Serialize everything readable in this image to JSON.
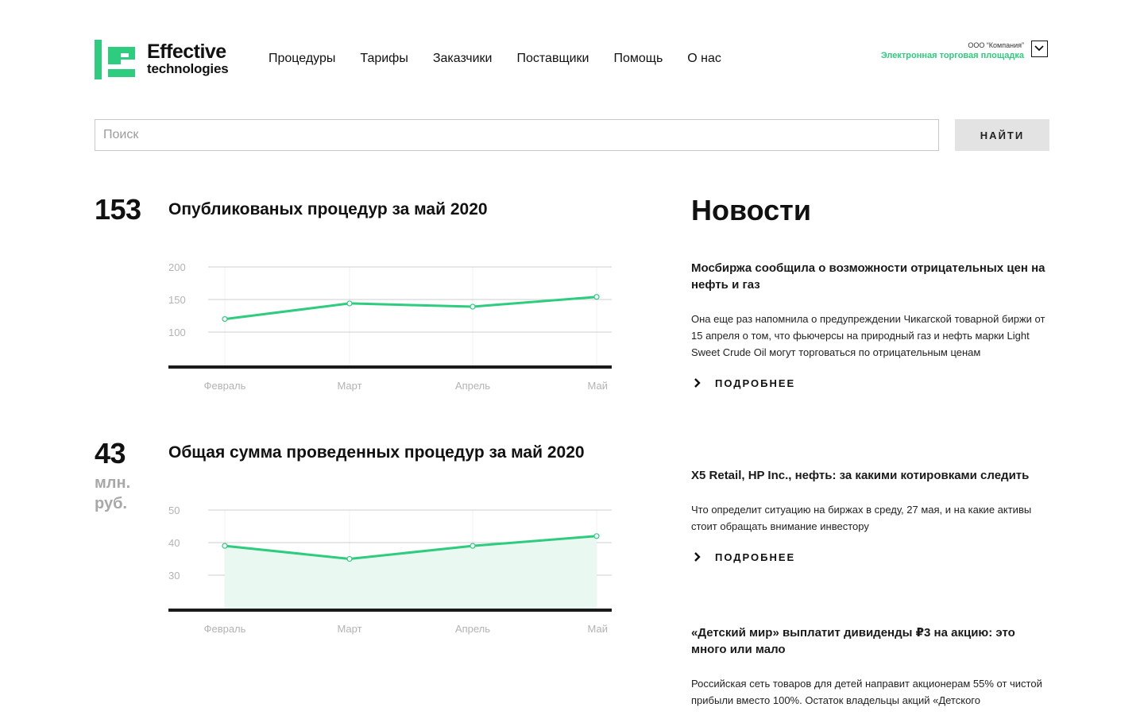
{
  "brand": {
    "line1": "Effective",
    "line2": "technologies",
    "color": "#2ecc7e"
  },
  "nav": [
    {
      "label": "Процедуры"
    },
    {
      "label": "Тарифы"
    },
    {
      "label": "Заказчики"
    },
    {
      "label": "Поставщики"
    },
    {
      "label": "Помощь"
    },
    {
      "label": "О нас"
    }
  ],
  "company": {
    "name": "ООО “Компания”",
    "subtitle": "Электронная торговая площадка",
    "dropdown_icon": "chevron-down-icon"
  },
  "search": {
    "placeholder": "Поиск",
    "value": "",
    "button_label": "НАЙТИ"
  },
  "stats": [
    {
      "value": "153",
      "unit": "",
      "title": "Опубликованых процедур за май 2020"
    },
    {
      "value": "43",
      "unit_line1": "млн.",
      "unit_line2": "руб.",
      "title": "Общая сумма проведенных процедур за май 2020"
    }
  ],
  "chart_data": [
    {
      "type": "line",
      "categories": [
        "Февраль",
        "Март",
        "Апрель",
        "Май"
      ],
      "series": [
        {
          "values": [
            120,
            144,
            139,
            154
          ]
        }
      ],
      "yticks": [
        100,
        150,
        200
      ],
      "ylim": [
        100,
        200
      ],
      "grid": true,
      "line_color": "#2ecc7e"
    },
    {
      "type": "area",
      "categories": [
        "Февраль",
        "Март",
        "Апрель",
        "Май"
      ],
      "series": [
        {
          "values": [
            39,
            35,
            39,
            42
          ]
        }
      ],
      "yticks": [
        30,
        40,
        50
      ],
      "ylim": [
        30,
        50
      ],
      "grid": true,
      "line_color": "#2ecc7e",
      "fill_color": "#e9f8f0"
    }
  ],
  "news": {
    "heading": "Новости",
    "more_label": "ПОДРОБНЕЕ",
    "items": [
      {
        "title": "Мосбиржа сообщила о возможности отрицательных цен на нефть и газ",
        "text": "Она еще раз напомнила о предупреждении Чикагской товарной биржи от 15 апреля о том, что фьючерсы на природный газ и нефть марки Light Sweet Crude Oil могут торговаться по отрицательным ценам"
      },
      {
        "title": "X5 Retail, HP Inc., нефть: за какими котировками следить",
        "text": "Что определит ситуацию на биржах в среду, 27 мая, и на какие активы стоит обращать внимание инвестору"
      },
      {
        "title": "«Детский мир» выплатит дивиденды ₽3 на акцию: это много или мало",
        "text": "Российская сеть товаров для детей направит акционерам 55% от чистой прибыли вместо 100%. Остаток владельцы акций «Детского"
      }
    ]
  }
}
